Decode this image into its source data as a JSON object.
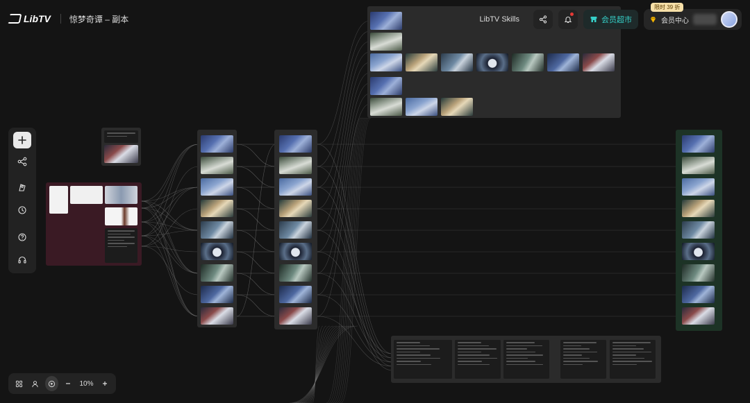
{
  "app": {
    "logo_text": "LibTV",
    "project_title": "惊梦奇谭 – 副本"
  },
  "header": {
    "skills_label": "LibTV Skills",
    "market_label": "会员超市",
    "vip_badge": "限时 39 折",
    "vip_label": "会员中心"
  },
  "left_toolbar": {
    "tools": [
      "add-icon",
      "workflow-icon",
      "assets-icon",
      "history-icon",
      "help-icon",
      "support-icon"
    ]
  },
  "bottom_toolbar": {
    "zoom_label": "10%"
  },
  "colors": {
    "canvas_bg": "#141414",
    "node_bg": "#2b2b2b",
    "character_node_bg": "#3a1a24",
    "output_node_bg": "#1d3326",
    "accent_teal": "#35d0c8",
    "vip_gold": "#f7e0a8"
  }
}
